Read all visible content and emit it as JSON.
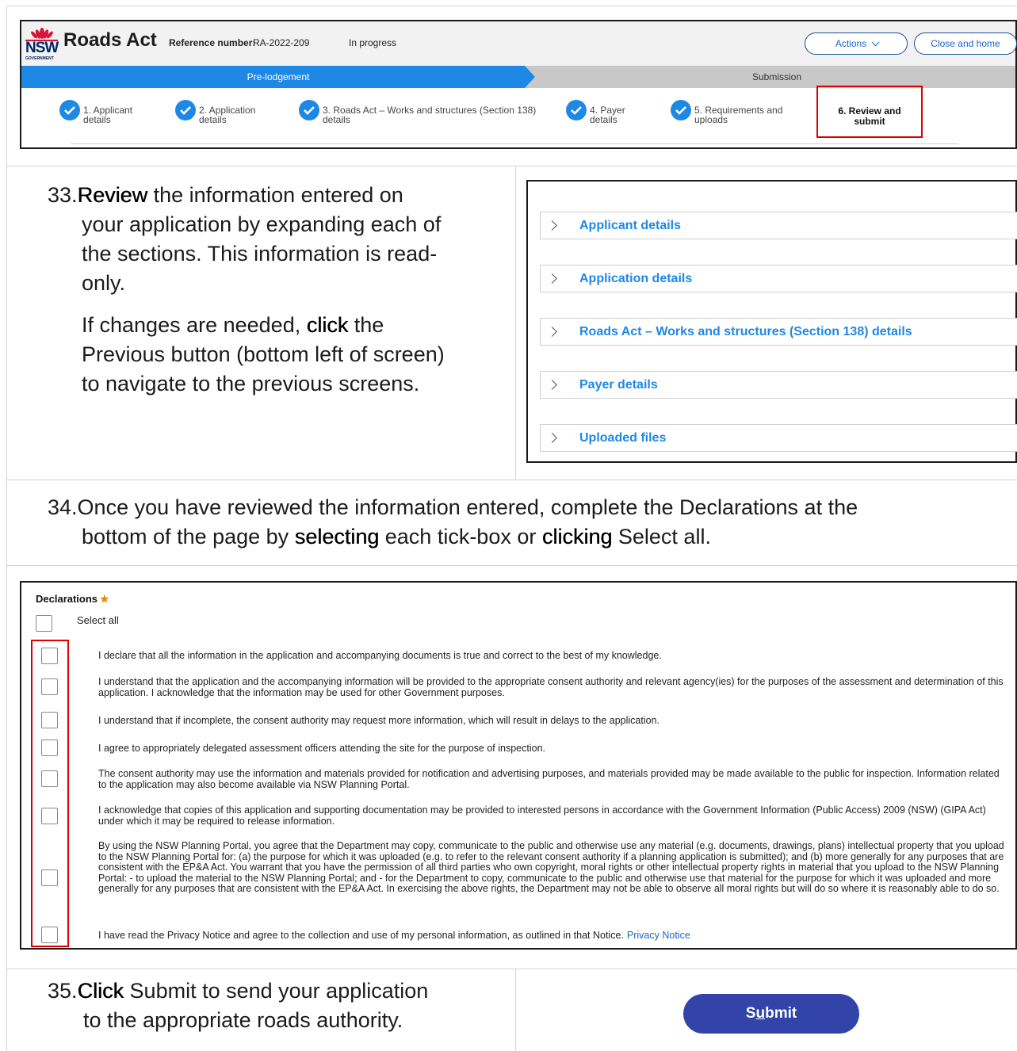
{
  "app": {
    "title": "Roads Act",
    "logo_text": "NSW",
    "logo_sub": "GOVERNMENT",
    "reference_label": "Reference number:",
    "reference_number": "RA-2022-209",
    "status": "In progress",
    "actions_label": "Actions",
    "close_home_label": "Close and home",
    "stages": [
      "Pre-lodgement",
      "Submission"
    ],
    "steps": [
      {
        "line1": "1. Applicant",
        "line2": "details",
        "completed": true
      },
      {
        "line1": "2. Application",
        "line2": "details",
        "completed": true
      },
      {
        "line1": "3. Roads Act – Works and structures (Section 138)",
        "line2": "details",
        "completed": true
      },
      {
        "line1": "4. Payer",
        "line2": "details",
        "completed": true
      },
      {
        "line1": "5. Requirements and",
        "line2": "uploads",
        "completed": true
      },
      {
        "line1": "6. Review and",
        "line2": "submit",
        "completed": false,
        "current": true
      }
    ],
    "brand_blue": "#1e88e5",
    "highlight_red": "#e00000"
  },
  "instructions": {
    "step33": {
      "number": "33.",
      "p1_bold": "Review",
      "p1_rest_a": " the information entered on",
      "p1_rest_b": "your application by expanding each of",
      "p1_rest_c": "the sections.  This information is read-",
      "p1_rest_d": "only.",
      "p2_a": "If changes are needed, ",
      "p2_bold": "click",
      "p2_b": " the",
      "p2_c": "Previous button (bottom left of screen)",
      "p2_d": "to navigate to the previous screens."
    },
    "step34": {
      "number": "34.",
      "a": "Once you have reviewed the information entered, complete the Declarations at the",
      "b": "bottom of the page by ",
      "bold1": "selecting",
      "c": " each tick-box or ",
      "bold2": "clicking",
      "d": " Select all."
    },
    "step35": {
      "number": "35. ",
      "bold": "Click",
      "a": " Submit to send your application",
      "b": "to the appropriate roads authority."
    }
  },
  "accordion": {
    "items": [
      {
        "label": "Applicant details"
      },
      {
        "label": "Application details"
      },
      {
        "label": "Roads Act – Works and structures (Section 138) details"
      },
      {
        "label": "Payer details"
      },
      {
        "label": "Uploaded files"
      }
    ]
  },
  "declarations": {
    "title": "Declarations",
    "required_mark": "★",
    "select_all_label": "Select all",
    "items": [
      {
        "text": "I declare that all the information in the application and accompanying documents is true and correct to the best of my knowledge.",
        "checked": false
      },
      {
        "text": "I understand that the application and the accompanying information will be provided to the appropriate consent authority and relevant agency(ies) for the purposes of the assessment and determination of this application. I acknowledge that the information may be used for other Government purposes.",
        "checked": false
      },
      {
        "text": "I understand that if incomplete, the consent authority may request more information, which will result in delays to the application.",
        "checked": false
      },
      {
        "text": "I agree to appropriately delegated assessment officers attending the site for the purpose of inspection.",
        "checked": false
      },
      {
        "text": "The consent authority may use the information and materials provided for notification and advertising purposes, and materials provided may be made available to the public for inspection. Information related to the application may also become available via NSW Planning Portal.",
        "checked": false
      },
      {
        "text": "I acknowledge that copies of this application and supporting documentation may be provided to interested persons in accordance with the Government Information (Public Access) 2009 (NSW) (GIPA Act) under which it may be required to release information.",
        "checked": false
      },
      {
        "text": "By using the NSW Planning Portal, you agree that the Department may copy, communicate to the public and otherwise use any material (e.g. documents, drawings, plans) intellectual property that you upload to the NSW Planning Portal for: (a) the purpose for which it was uploaded (e.g. to refer to the relevant consent authority if a planning application is submitted); and (b) more generally for any purposes that are consistent with the EP&A Act. You warrant that you have the permission of all third parties who own copyright, moral rights or other intellectual property rights in material that you upload to the NSW Planning Portal: - to upload the material to the NSW Planning Portal; and - for the Department to copy, communicate to the public and otherwise use that material for the purpose for which it was uploaded and more generally for any purposes that are consistent with the EP&A Act. In exercising the above rights, the Department may not be able to observe all moral rights but will do so where it is reasonably able to do so.",
        "checked": false
      },
      {
        "text": "I have read the Privacy Notice and agree to the collection and use of my personal information, as outlined in that Notice.",
        "checked": false,
        "link": "Privacy Notice"
      }
    ]
  },
  "submit": {
    "label_pre": "S",
    "label_u": "u",
    "label_post": "bmit",
    "color": "#3344a8"
  }
}
